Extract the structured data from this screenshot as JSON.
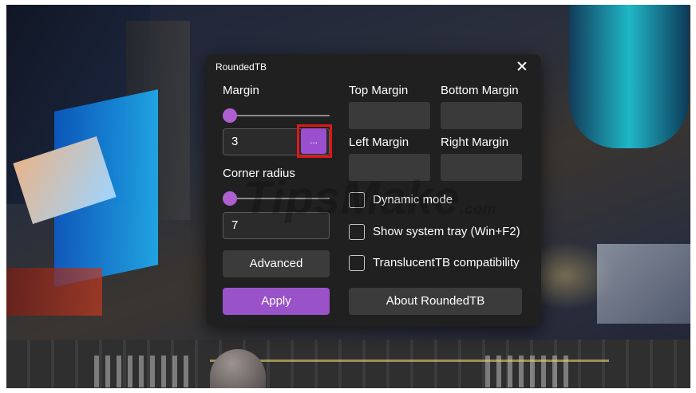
{
  "window": {
    "title": "RoundedTB"
  },
  "margin": {
    "label": "Margin",
    "value": "3",
    "slider_level": 0.0,
    "ellipsis_label": "..."
  },
  "corner": {
    "label": "Corner radius",
    "value": "7",
    "slider_level": 0.0
  },
  "margins": {
    "top_label": "Top Margin",
    "bottom_label": "Bottom Margin",
    "left_label": "Left Margin",
    "right_label": "Right Margin"
  },
  "options": {
    "dynamic_mode": "Dynamic mode",
    "show_tray": "Show system tray (Win+F2)",
    "translucent": "TranslucentTB compatibility"
  },
  "buttons": {
    "advanced": "Advanced",
    "apply": "Apply",
    "about": "About RoundedTB"
  },
  "watermark": {
    "main": "TipsMake",
    "suffix": ".com"
  },
  "colors": {
    "accent": "#9a4fcf",
    "apply_bg": "#9a52c9",
    "dialog_bg": "#202020",
    "highlight": "#e01717"
  }
}
